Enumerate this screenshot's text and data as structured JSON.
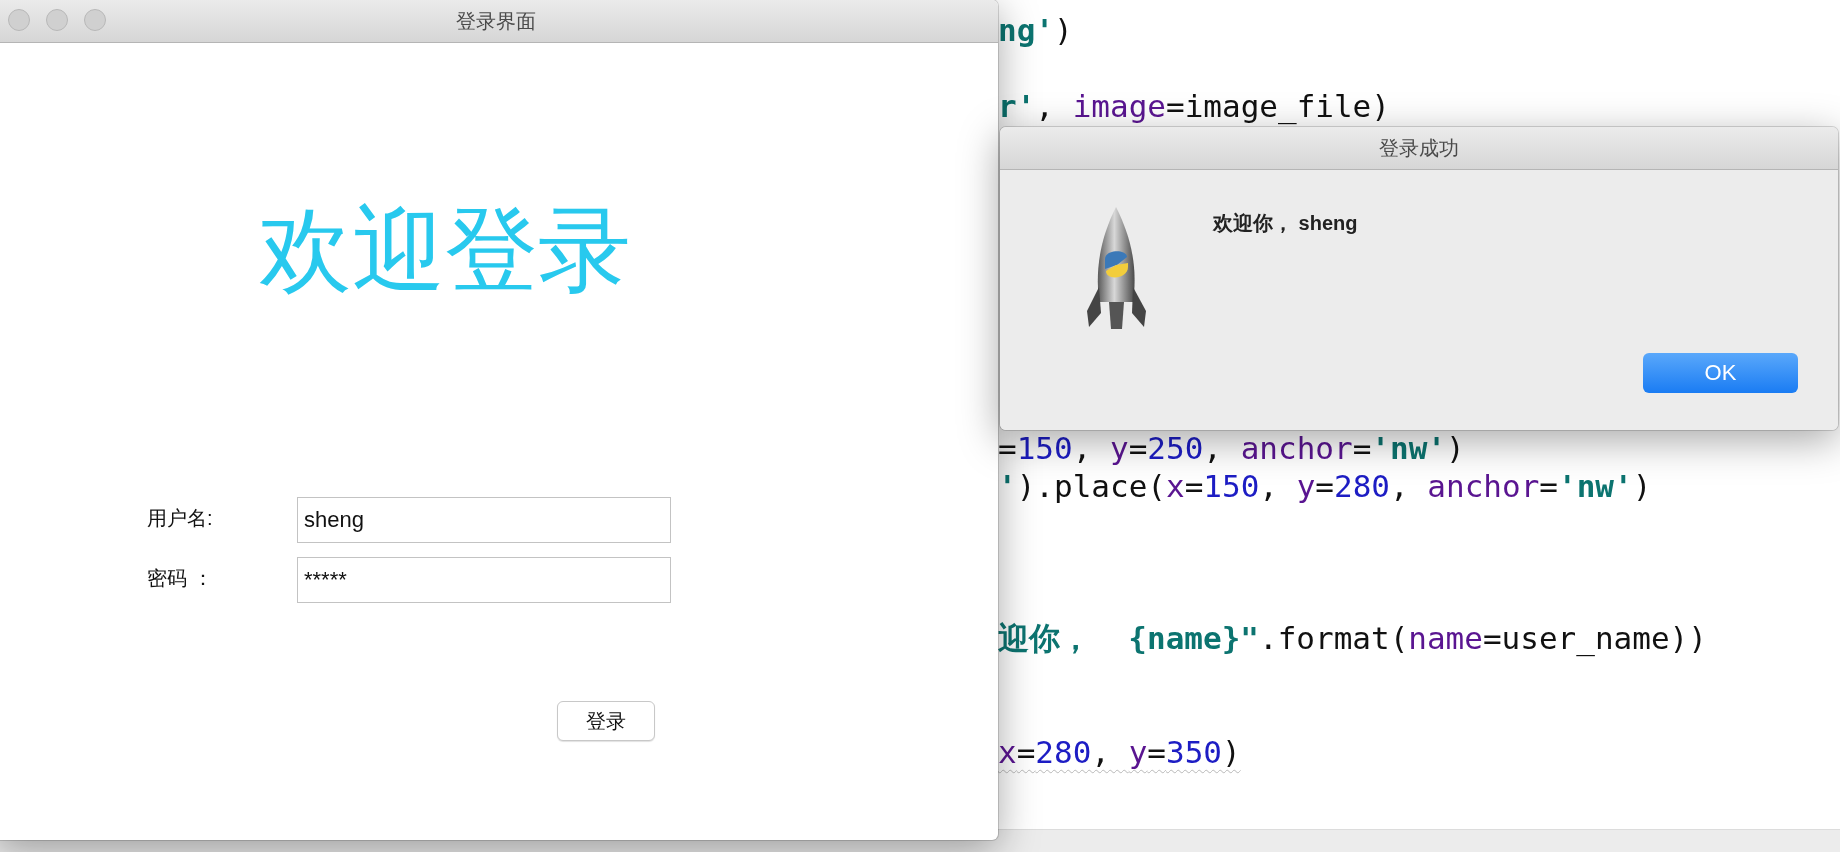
{
  "editor": {
    "lines": [
      {
        "tokens": [
          {
            "kind": "string",
            "text": "ng'"
          },
          {
            "kind": "plain",
            "text": ")"
          }
        ]
      },
      {
        "tokens": [
          {
            "kind": "string",
            "text": "r'"
          },
          {
            "kind": "plain",
            "text": ", "
          },
          {
            "kind": "param",
            "text": "image"
          },
          {
            "kind": "plain",
            "text": "=image_file)"
          }
        ]
      },
      {
        "tokens": [
          {
            "kind": "plain",
            "text": "="
          },
          {
            "kind": "number",
            "text": "150"
          },
          {
            "kind": "plain",
            "text": ", "
          },
          {
            "kind": "param",
            "text": "y"
          },
          {
            "kind": "plain",
            "text": "="
          },
          {
            "kind": "number",
            "text": "250"
          },
          {
            "kind": "plain",
            "text": ", "
          },
          {
            "kind": "param",
            "text": "anchor"
          },
          {
            "kind": "plain",
            "text": "="
          },
          {
            "kind": "string",
            "text": "'nw'"
          },
          {
            "kind": "plain",
            "text": ")"
          }
        ]
      },
      {
        "tokens": [
          {
            "kind": "string",
            "text": "'"
          },
          {
            "kind": "plain",
            "text": ").place("
          },
          {
            "kind": "param",
            "text": "x"
          },
          {
            "kind": "plain",
            "text": "="
          },
          {
            "kind": "number",
            "text": "150"
          },
          {
            "kind": "plain",
            "text": ", "
          },
          {
            "kind": "param",
            "text": "y"
          },
          {
            "kind": "plain",
            "text": "="
          },
          {
            "kind": "number",
            "text": "280"
          },
          {
            "kind": "plain",
            "text": ", "
          },
          {
            "kind": "param",
            "text": "anchor"
          },
          {
            "kind": "plain",
            "text": "="
          },
          {
            "kind": "string",
            "text": "'nw'"
          },
          {
            "kind": "plain",
            "text": ")"
          }
        ]
      },
      {
        "tokens": [
          {
            "kind": "string",
            "text": "迎你，  {name}\""
          },
          {
            "kind": "plain",
            "text": ".format("
          },
          {
            "kind": "param",
            "text": "name"
          },
          {
            "kind": "plain",
            "text": "=user_name))"
          }
        ]
      },
      {
        "warning": true,
        "tokens": [
          {
            "kind": "param",
            "text": "x"
          },
          {
            "kind": "plain",
            "text": "="
          },
          {
            "kind": "number",
            "text": "280"
          },
          {
            "kind": "plain",
            "text": ", "
          },
          {
            "kind": "param",
            "text": "y"
          },
          {
            "kind": "plain",
            "text": "="
          },
          {
            "kind": "number",
            "text": "350"
          },
          {
            "kind": "plain",
            "text": ")"
          }
        ]
      }
    ]
  },
  "login_window": {
    "title": "登录界面",
    "heading": "欢迎登录",
    "fields": [
      {
        "label": "用户名:",
        "value": "sheng"
      },
      {
        "label": "密码 ：",
        "value": "*****"
      }
    ],
    "button": "登录"
  },
  "dialog": {
    "title": "登录成功",
    "message": "欢迎你， sheng",
    "button": "OK"
  }
}
